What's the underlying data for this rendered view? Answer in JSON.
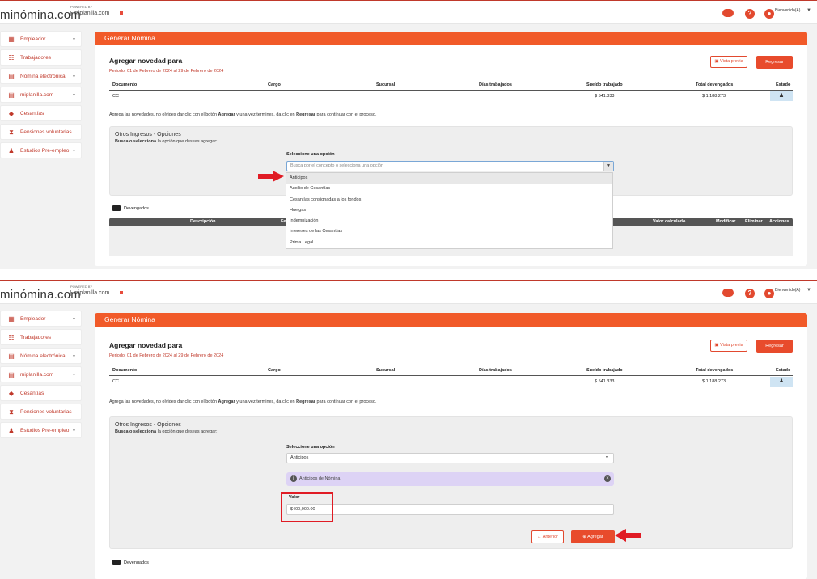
{
  "topbar": {
    "logo": "minómina.com",
    "powered_by": "POWERED BY",
    "sub_logo": "miplanilla.com",
    "welcome": "Bienvenido(A)",
    "icons": [
      "chat-icon",
      "help-icon",
      "user-icon",
      "chevron-down-icon"
    ]
  },
  "sidebar": {
    "items": [
      {
        "label": "Empleador",
        "icon": "building-icon",
        "has_chevron": true
      },
      {
        "label": "Trabajadores",
        "icon": "users-icon",
        "has_chevron": false
      },
      {
        "label": "Nómina electrónica",
        "icon": "document-icon",
        "has_chevron": true
      },
      {
        "label": "miplanilla.com",
        "icon": "document-icon",
        "has_chevron": true
      },
      {
        "label": "Cesantías",
        "icon": "piggy-bank-icon",
        "has_chevron": false
      },
      {
        "label": "Pensiones voluntarias",
        "icon": "hourglass-icon",
        "has_chevron": false
      },
      {
        "label": "Estudios Pre-empleo",
        "icon": "user-dollar-icon",
        "has_chevron": true
      }
    ]
  },
  "panel": {
    "header": "Generar Nómina",
    "title": "Agregar novedad para",
    "period": "Periodo: 01 de Febrero de 2024 al 29 de Febrero de 2024",
    "preview_button": "Vista previa",
    "back_button": "Regresar",
    "table": {
      "headers": [
        "Documento",
        "Cargo",
        "Sucursal",
        "Días trabajados",
        "Sueldo trabajado",
        "Total devengados",
        "Estado"
      ],
      "row": {
        "documento": "CC",
        "sueldo": "$ 541.333",
        "total": "$ 1.188.273"
      }
    },
    "note_prefix": "Agrega las novedades, no olvides dar clic con el botón ",
    "note_agregar": "Agregar",
    "note_mid": " y una vez termines, da clic en ",
    "note_regresar": "Regresar",
    "note_suffix": " para continuar con el proceso.",
    "options": {
      "title": "Otros Ingresos - Opciones",
      "sub_bold": "Busca o selecciona",
      "sub_rest": " la opción que deseas agregar:",
      "select_label": "Seleccione una opción",
      "placeholder": "Busca por el concepto o selecciona una opción",
      "dropdown": [
        "Anticipos",
        "Auxilio de Cesantías",
        "Cesantías consignadas a los fondos",
        "Huelgas",
        "Indemnización",
        "Intereses de las Cesantías",
        "Prima Legal"
      ]
    },
    "devengados": {
      "label": "Devengados",
      "headers": {
        "descripcion": "Descripción",
        "fe": "Fe",
        "valor": "Valor calculado",
        "modificar": "Modificar",
        "eliminar": "Eliminar",
        "acciones": "Acciones"
      }
    }
  },
  "step2": {
    "selected_value": "Anticipos",
    "info_text": "Anticipos de Nómina",
    "valor_label": "Valor",
    "valor_value": "$400,000.00",
    "prev_button": "Anterior",
    "add_button": "Agregar"
  },
  "colors": {
    "accent": "#f15a29",
    "highlight_frame": "#e01b24",
    "info_bg": "#ddd3f5"
  }
}
